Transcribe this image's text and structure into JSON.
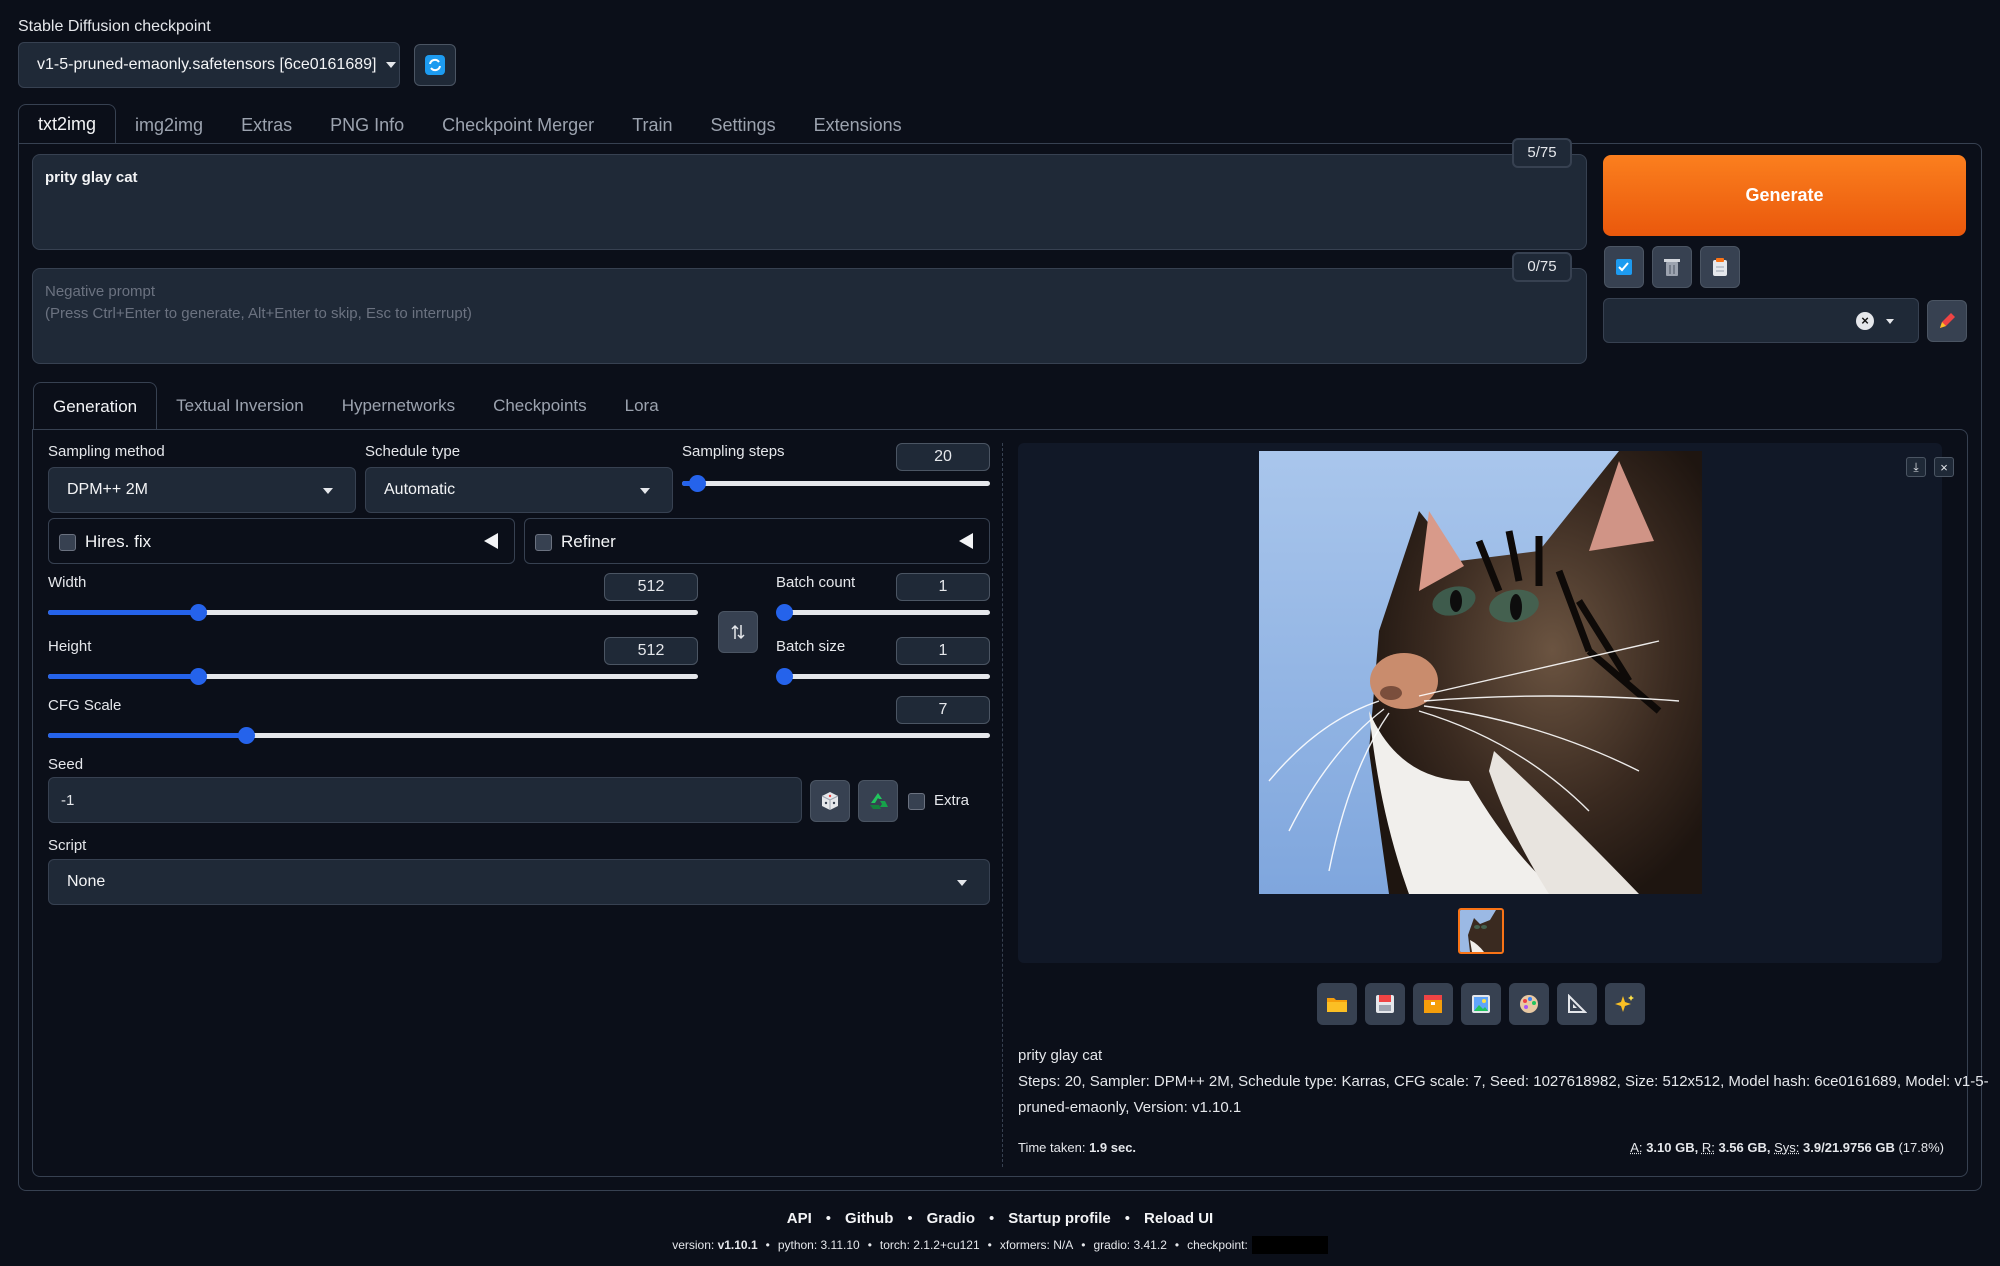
{
  "checkpoint": {
    "label": "Stable Diffusion checkpoint",
    "value": "v1-5-pruned-emaonly.safetensors [6ce0161689]"
  },
  "main_tabs": [
    "txt2img",
    "img2img",
    "Extras",
    "PNG Info",
    "Checkpoint Merger",
    "Train",
    "Settings",
    "Extensions"
  ],
  "prompt": {
    "value": "prity glay cat",
    "token_count": "5/75"
  },
  "negative_prompt": {
    "placeholder_line1": "Negative prompt",
    "placeholder_line2": "(Press Ctrl+Enter to generate, Alt+Enter to skip, Esc to interrupt)",
    "token_count": "0/75"
  },
  "generate_label": "Generate",
  "sub_tabs": [
    "Generation",
    "Textual Inversion",
    "Hypernetworks",
    "Checkpoints",
    "Lora"
  ],
  "sampling": {
    "method_label": "Sampling method",
    "method_value": "DPM++ 2M",
    "schedule_label": "Schedule type",
    "schedule_value": "Automatic",
    "steps_label": "Sampling steps",
    "steps_value": "20",
    "steps_fraction": 0.05
  },
  "hires_label": "Hires. fix",
  "refiner_label": "Refiner",
  "width": {
    "label": "Width",
    "value": "512",
    "fraction": 0.23
  },
  "height": {
    "label": "Height",
    "value": "512",
    "fraction": 0.23
  },
  "batch_count": {
    "label": "Batch count",
    "value": "1",
    "fraction": 0.0
  },
  "batch_size": {
    "label": "Batch size",
    "value": "1",
    "fraction": 0.0
  },
  "cfg": {
    "label": "CFG Scale",
    "value": "7",
    "fraction": 0.21
  },
  "seed": {
    "label": "Seed",
    "value": "-1",
    "extra_label": "Extra"
  },
  "script": {
    "label": "Script",
    "value": "None"
  },
  "output": {
    "prompt": "prity glay cat",
    "params_line1": "Steps: 20, Sampler: DPM++ 2M, Schedule type: Karras, CFG scale: 7, Seed: 1027618982, Size: 512x512, Model hash: 6ce0161689, Model: v1-5-",
    "params_line2": "pruned-emaonly, Version: v1.10.1",
    "time_label": "Time taken:",
    "time_value": "1.9 sec.",
    "mem_a_label": "A:",
    "mem_a": "3.10 GB,",
    "mem_r_label": "R:",
    "mem_r": "3.56 GB,",
    "mem_sys_label": "Sys:",
    "mem_sys": "3.9/21.9756 GB",
    "mem_pct": "(17.8%)"
  },
  "footer": {
    "links": [
      "API",
      "Github",
      "Gradio",
      "Startup profile",
      "Reload UI"
    ],
    "version_label": "version:",
    "version": "v1.10.1",
    "python_label": "python:",
    "python": "3.11.10",
    "torch_label": "torch:",
    "torch": "2.1.2+cu121",
    "xformers_label": "xformers:",
    "xformers": "N/A",
    "gradio_label": "gradio:",
    "gradio": "3.41.2",
    "checkpoint_label": "checkpoint:"
  },
  "colors": {
    "accent": "#f97316",
    "slider": "#2563eb",
    "background": "#0b0f19"
  }
}
